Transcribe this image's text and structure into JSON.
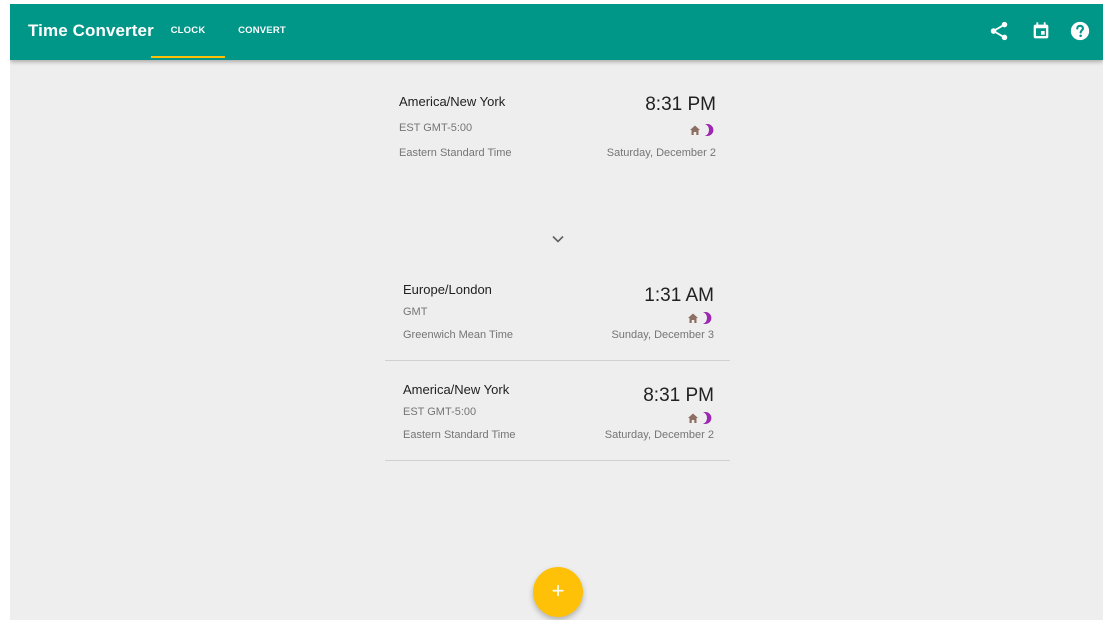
{
  "app": {
    "title": "Time Converter",
    "accent_color": "#009688",
    "highlight_color": "#ffc107"
  },
  "tabs": [
    {
      "label": "CLOCK",
      "selected": true
    },
    {
      "label": "CONVERT",
      "selected": false
    }
  ],
  "toolbar": {
    "icons": [
      "share-icon",
      "calendar-icon",
      "help-icon"
    ]
  },
  "home_clock": {
    "zone": "America/New York",
    "abbr": "EST GMT-5:00",
    "name": "Eastern Standard Time",
    "time": "8:31 PM",
    "date": "Saturday, December 2",
    "icons": [
      "home-icon",
      "moon-icon"
    ]
  },
  "clocks": [
    {
      "zone": "Europe/London",
      "abbr": "GMT",
      "name": "Greenwich Mean Time",
      "time": "1:31 AM",
      "date": "Sunday, December 3",
      "icons": [
        "home-icon",
        "moon-icon"
      ]
    },
    {
      "zone": "America/New York",
      "abbr": "EST GMT-5:00",
      "name": "Eastern Standard Time",
      "time": "8:31 PM",
      "date": "Saturday, December 2",
      "icons": [
        "home-icon",
        "moon-icon"
      ]
    }
  ],
  "fab": {
    "label": "+",
    "color": "#ffc107"
  }
}
